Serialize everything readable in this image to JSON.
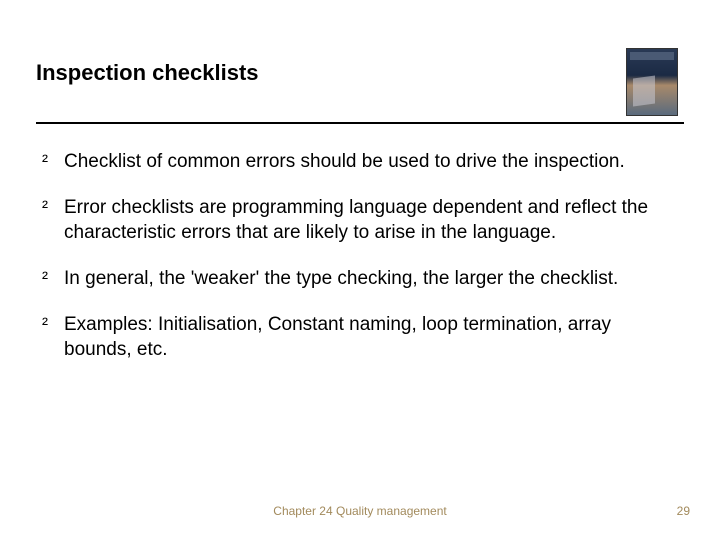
{
  "title": "Inspection checklists",
  "bullets": [
    "Checklist of common errors should be used to drive the inspection.",
    "Error checklists are programming language dependent and reflect the characteristic errors that are likely to arise in the language.",
    "In general, the 'weaker' the type checking, the larger the checklist.",
    "Examples: Initialisation, Constant naming, loop termination, array bounds, etc."
  ],
  "footer": "Chapter 24 Quality management",
  "page_number": "29",
  "bullet_glyph": "²"
}
